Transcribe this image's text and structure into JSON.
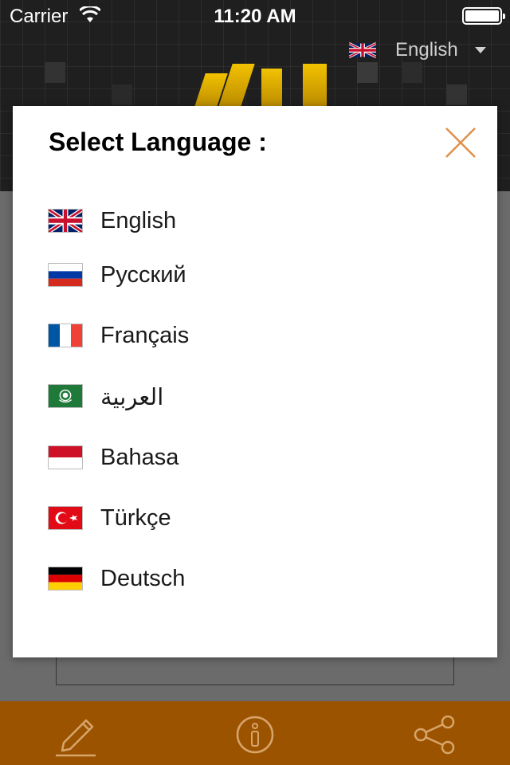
{
  "status_bar": {
    "carrier": "Carrier",
    "time": "11:20 AM"
  },
  "header": {
    "language_label": "English"
  },
  "modal": {
    "title": "Select Language :",
    "languages": [
      {
        "name": "English",
        "flag": "uk-flag-icon"
      },
      {
        "name": "Русский",
        "flag": "russia-flag-icon"
      },
      {
        "name": "Français",
        "flag": "france-flag-icon"
      },
      {
        "name": "العربية",
        "flag": "arab-league-flag-icon"
      },
      {
        "name": "Bahasa",
        "flag": "indonesia-flag-icon"
      },
      {
        "name": "Türkçe",
        "flag": "turkey-flag-icon"
      },
      {
        "name": "Deutsch",
        "flag": "germany-flag-icon"
      }
    ]
  },
  "bottom_bar": {
    "tabs": [
      {
        "icon": "pencil-icon"
      },
      {
        "icon": "info-icon"
      },
      {
        "icon": "share-icon"
      }
    ]
  },
  "colors": {
    "accent": "#9c5300",
    "close_icon": "#e0904a",
    "modal_bg": "#ffffff"
  }
}
